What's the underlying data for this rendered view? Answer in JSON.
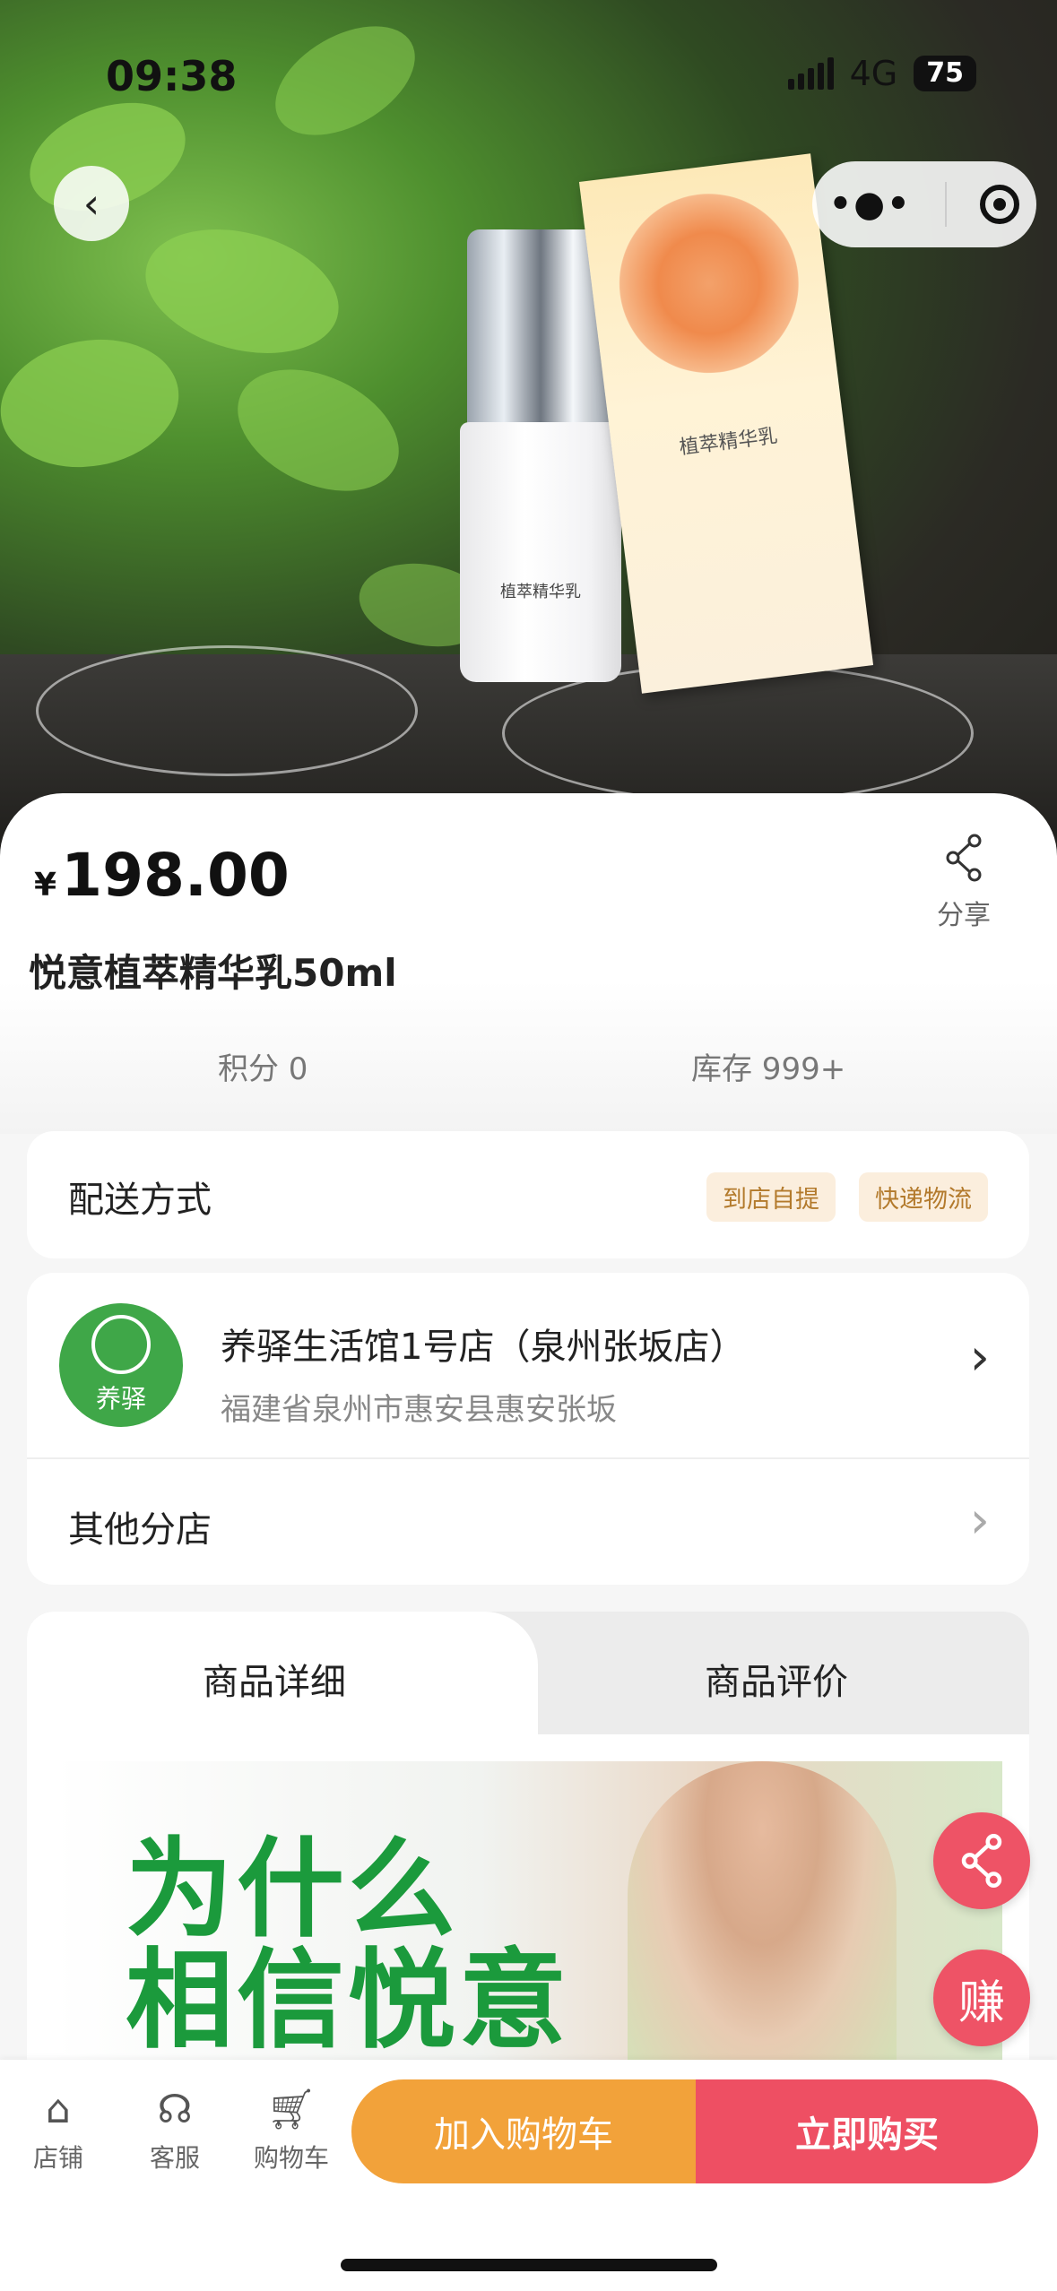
{
  "status": {
    "time": "09:38",
    "network": "4G",
    "battery": "75"
  },
  "hero": {
    "bottle_label": "植萃精华乳",
    "box_label": "植萃精华乳"
  },
  "product": {
    "currency": "¥",
    "price": "198.00",
    "share_label": "分享",
    "title": "悦意植萃精华乳50ml",
    "points": "积分 0",
    "stock": "库存 999+"
  },
  "delivery": {
    "label": "配送方式",
    "options": [
      "到店自提",
      "快递物流"
    ]
  },
  "store": {
    "logo_text": "养驿",
    "name": "养驿生活馆1号店（泉州张坂店）",
    "address": "福建省泉州市惠安县惠安张坂",
    "other_label": "其他分店"
  },
  "tabs": {
    "detail": "商品详细",
    "reviews": "商品评价"
  },
  "banner": {
    "line1": "为什么",
    "line2": "相信悦意"
  },
  "fab": {
    "earn": "赚"
  },
  "bottom_nav": {
    "shop": "店铺",
    "service": "客服",
    "cart": "购物车",
    "add_to_cart": "加入购物车",
    "buy_now": "立即购买"
  },
  "colors": {
    "accent_red": "#ee4f63",
    "accent_orange": "#f2a23a",
    "brand_green": "#3fa748"
  }
}
